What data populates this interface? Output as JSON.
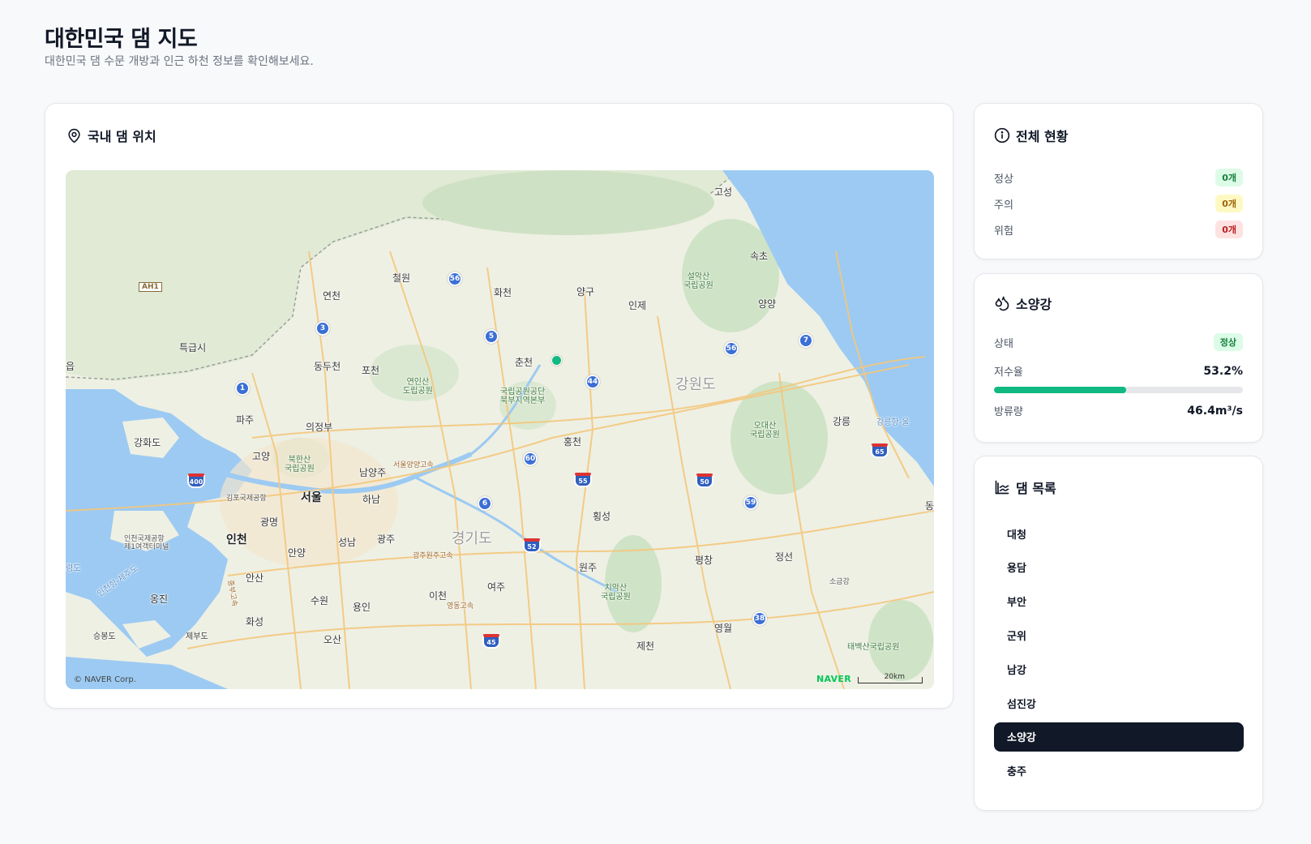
{
  "header": {
    "title": "대한민국 댐 지도",
    "subtitle": "대한민국 댐 수문 개방과 인근 하천 정보를 확인해보세요."
  },
  "map_card": {
    "title": "국내 댐 위치",
    "copyright": "© NAVER Corp.",
    "logo": "NAVER",
    "scale": "20km",
    "labels": {
      "goseong": "고성",
      "sokcho": "속초",
      "yangyang": "양양",
      "inje": "인제",
      "yanggu": "양구",
      "hwacheon": "화천",
      "cheorwon": "철원",
      "yeoncheon": "연천",
      "chuncheon": "춘천",
      "gangwondo": "강원도",
      "gangneung": "강릉",
      "hongcheon": "홍천",
      "hoengseong": "횡성",
      "pocheon": "포천",
      "dongducheon": "동두천",
      "paju": "파주",
      "uijeongbu": "의정부",
      "goyang": "고양",
      "namyangju": "남양주",
      "seoul": "서울",
      "hanam": "하남",
      "gwangmyeong": "광명",
      "incheon": "인천",
      "anyang": "안양",
      "seongnam": "성남",
      "gwangju": "광주",
      "gyeonggido": "경기도",
      "wonju": "원주",
      "pyeongchang": "평창",
      "jeongseon": "정선",
      "yeoju": "여주",
      "icheon": "이천",
      "yongin": "용인",
      "suwon": "수원",
      "ansan": "안산",
      "hwaseong": "화성",
      "osan": "오산",
      "jecheon": "제천",
      "yeongwol": "영월",
      "ganghwado": "강화도",
      "ongjin": "옹진",
      "teukgeupsi": "특급시",
      "eup": "읍",
      "dong": "동",
      "seungbongdo": "승봉도",
      "jebudo": "제부도",
      "yeongdo": "령도",
      "sogeumgang": "소금강",
      "seoraksan": "설악산\n국립공원",
      "odaesan": "오대산\n국립공원",
      "chiaksan": "치악산\n국립공원",
      "taebaeksan": "태백산국립공원",
      "bukhansan": "북한산\n국립공원",
      "yeoninsan": "연인산\n도립공원",
      "national_park_office": "국립공원공단\n북부지역본부",
      "gimpo_airport": "김포국제공항",
      "incheon_airport": "인천국제공항\n제1여객터미널",
      "incheon_jeju": "인천항-제주도",
      "gangneung_port": "강릉항-울",
      "seoul_yangyang_exp": "서울양양고속",
      "gwangju_wonju_exp": "광주원주고속",
      "yeongdong_exp": "영동고속",
      "jungbu_exp": "중부고속",
      "ah1": "AH1"
    },
    "routes": [
      "56",
      "3",
      "5",
      "1",
      "44",
      "60",
      "6",
      "56",
      "7",
      "59",
      "38",
      "44"
    ],
    "highways": [
      "400",
      "55",
      "50",
      "65",
      "52",
      "45"
    ]
  },
  "status_card": {
    "title": "전체 현황",
    "rows": [
      {
        "label": "정상",
        "count": "0개",
        "color": "#dcfce7",
        "text_color": "#15803d"
      },
      {
        "label": "주의",
        "count": "0개",
        "color": "#fef9c3",
        "text_color": "#a16207"
      },
      {
        "label": "위험",
        "count": "0개",
        "color": "#fee2e2",
        "text_color": "#b91c1c"
      }
    ]
  },
  "detail_card": {
    "title": "소양강",
    "status_label": "상태",
    "status_value": "정상",
    "storage_label": "저수율",
    "storage_value": "53.2%",
    "storage_fraction": 0.532,
    "discharge_label": "방류량",
    "discharge_value": "46.4m³/s",
    "accent": "#10b981"
  },
  "list_card": {
    "title": "댐 목록",
    "items": [
      "대청",
      "용담",
      "부안",
      "군위",
      "남강",
      "섬진강",
      "소양강",
      "충주"
    ],
    "active": "소양강"
  }
}
